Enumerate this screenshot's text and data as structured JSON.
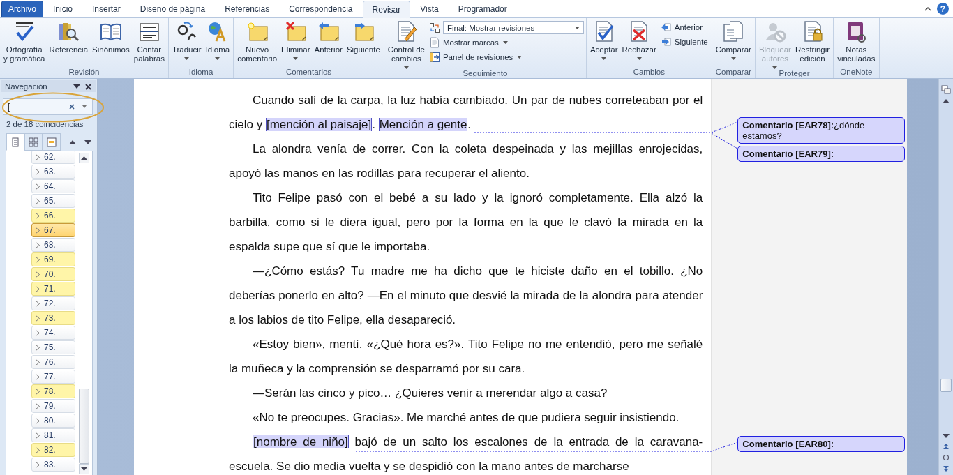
{
  "ribbon_tabs": [
    {
      "label": "Archivo",
      "kind": "file",
      "selected": false
    },
    {
      "label": "Inicio",
      "kind": "tab",
      "selected": false
    },
    {
      "label": "Insertar",
      "kind": "tab",
      "selected": false
    },
    {
      "label": "Diseño de página",
      "kind": "tab",
      "selected": false
    },
    {
      "label": "Referencias",
      "kind": "tab",
      "selected": false
    },
    {
      "label": "Correspondencia",
      "kind": "tab",
      "selected": false
    },
    {
      "label": "Revisar",
      "kind": "tab",
      "selected": true
    },
    {
      "label": "Vista",
      "kind": "tab",
      "selected": false
    },
    {
      "label": "Programador",
      "kind": "tab",
      "selected": false
    }
  ],
  "help_button": "?",
  "ribbon_groups": [
    {
      "label": "Revisión",
      "items": [
        {
          "kind": "large",
          "lines": [
            "Ortografía",
            "y gramática"
          ]
        },
        {
          "kind": "large",
          "lines": [
            "Referencia"
          ]
        },
        {
          "kind": "large",
          "lines": [
            "Sinónimos"
          ]
        },
        {
          "kind": "large",
          "lines": [
            "Contar",
            "palabras"
          ]
        }
      ]
    },
    {
      "label": "Idioma",
      "items": [
        {
          "kind": "large",
          "lines": [
            "Traducir"
          ],
          "has_menu": true
        },
        {
          "kind": "large",
          "lines": [
            "Idioma"
          ],
          "has_menu": true
        }
      ]
    },
    {
      "label": "Comentarios",
      "items": [
        {
          "kind": "large",
          "lines": [
            "Nuevo",
            "comentario"
          ]
        },
        {
          "kind": "large",
          "lines": [
            "Eliminar"
          ],
          "has_menu": true
        },
        {
          "kind": "large",
          "lines": [
            "Anterior"
          ]
        },
        {
          "kind": "large",
          "lines": [
            "Siguiente"
          ]
        }
      ]
    },
    {
      "label": "Seguimiento",
      "items": [
        {
          "kind": "large",
          "lines": [
            "Control de",
            "cambios"
          ],
          "has_menu": true
        },
        {
          "kind": "combo",
          "value": "Final: Mostrar revisiones"
        },
        {
          "kind": "small",
          "label": "Mostrar marcas",
          "has_menu": true
        },
        {
          "kind": "small",
          "label": "Panel de revisiones",
          "has_menu": true
        }
      ]
    },
    {
      "label": "Cambios",
      "items": [
        {
          "kind": "large",
          "lines": [
            "Aceptar"
          ],
          "has_menu": true
        },
        {
          "kind": "large",
          "lines": [
            "Rechazar"
          ],
          "has_menu": true
        },
        {
          "kind": "small",
          "label": "Anterior"
        },
        {
          "kind": "small",
          "label": "Siguiente"
        }
      ]
    },
    {
      "label": "Comparar",
      "items": [
        {
          "kind": "large",
          "lines": [
            "Comparar"
          ],
          "has_menu": true
        }
      ]
    },
    {
      "label": "Proteger",
      "items": [
        {
          "kind": "large",
          "lines": [
            "Bloquear",
            "autores"
          ],
          "has_menu": true,
          "disabled": true
        },
        {
          "kind": "large",
          "lines": [
            "Restringir",
            "edición"
          ]
        }
      ]
    },
    {
      "label": "OneNote",
      "items": [
        {
          "kind": "large",
          "lines": [
            "Notas",
            "vinculadas"
          ]
        }
      ]
    }
  ],
  "nav": {
    "title": "Navegación",
    "search_value": "[",
    "result_count": "2 de 18 coincidencias",
    "view_buttons": [
      {
        "selected": true
      },
      {
        "selected": false
      },
      {
        "selected": false
      }
    ],
    "headings": [
      {
        "label": "62.",
        "match": false,
        "selected": false
      },
      {
        "label": "63.",
        "match": false,
        "selected": false
      },
      {
        "label": "64.",
        "match": false,
        "selected": false
      },
      {
        "label": "65.",
        "match": false,
        "selected": false
      },
      {
        "label": "66.",
        "match": true,
        "selected": false
      },
      {
        "label": "67.",
        "match": true,
        "selected": true
      },
      {
        "label": "68.",
        "match": false,
        "selected": false
      },
      {
        "label": "69.",
        "match": true,
        "selected": false
      },
      {
        "label": "70.",
        "match": true,
        "selected": false
      },
      {
        "label": "71.",
        "match": true,
        "selected": false
      },
      {
        "label": "72.",
        "match": false,
        "selected": false
      },
      {
        "label": "73.",
        "match": true,
        "selected": false
      },
      {
        "label": "74.",
        "match": false,
        "selected": false
      },
      {
        "label": "75.",
        "match": false,
        "selected": false
      },
      {
        "label": "76.",
        "match": false,
        "selected": false
      },
      {
        "label": "77.",
        "match": false,
        "selected": false
      },
      {
        "label": "78.",
        "match": true,
        "selected": false
      },
      {
        "label": "79.",
        "match": false,
        "selected": false
      },
      {
        "label": "80.",
        "match": false,
        "selected": false
      },
      {
        "label": "81.",
        "match": false,
        "selected": false
      },
      {
        "label": "82.",
        "match": true,
        "selected": false
      },
      {
        "label": "83.",
        "match": false,
        "selected": false
      }
    ]
  },
  "document": {
    "paragraphs": [
      [
        {
          "text": "Cuando salí de la carpa, la luz había cambiado. Un par de nubes correteaban por el cielo y ",
          "comment": false
        },
        {
          "text": "[mención al paisaje]",
          "comment": true
        },
        {
          "text": ". ",
          "comment": false
        },
        {
          "text": "Mención a gente",
          "comment": true
        },
        {
          "text": ".",
          "comment": false
        }
      ],
      [
        {
          "text": "La alondra venía de correr. Con la coleta despeinada y las mejillas enrojecidas, apoyó las manos en las rodillas para recuperar el aliento.",
          "comment": false
        }
      ],
      [
        {
          "text": "Tito Felipe pasó con el bebé a su lado y la ignoró completamente. Ella alzó la barbilla, como si le diera igual, pero por la forma en la que le clavó la mirada en la espalda supe que sí que le importaba.",
          "comment": false
        }
      ],
      [
        {
          "text": "—¿Cómo estás? Tu madre me ha dicho que te hiciste daño en el tobillo. ¿No deberías ponerlo en alto? —En el minuto que desvié la mirada de la alondra para atender a los labios de tito Felipe, ella desapareció.",
          "comment": false
        }
      ],
      [
        {
          "text": "«Estoy bien», mentí. «¿Qué hora es?». Tito Felipe no me entendió, pero me señalé la muñeca y la comprensión se desparramó por su cara.",
          "comment": false
        }
      ],
      [
        {
          "text": "—Serán las cinco y pico… ¿Quieres venir a merendar algo a casa?",
          "comment": false
        }
      ],
      [
        {
          "text": "«No te preocupes. Gracias». Me marché antes de que pudiera seguir insistiendo.",
          "comment": false
        }
      ],
      [
        {
          "text": "[nombre de niño]",
          "comment": true
        },
        {
          "text": " bajó de un salto los escalones de la entrada de la caravana-escuela. Se dio media vuelta y se despidió con la mano antes de marcharse",
          "comment": false
        }
      ]
    ],
    "comments": [
      {
        "label": "Comentario [EAR78]:",
        "text": "¿dónde estamos?"
      },
      {
        "label": "Comentario [EAR79]:"
      },
      {
        "label": "Comentario [EAR80]:"
      }
    ]
  }
}
